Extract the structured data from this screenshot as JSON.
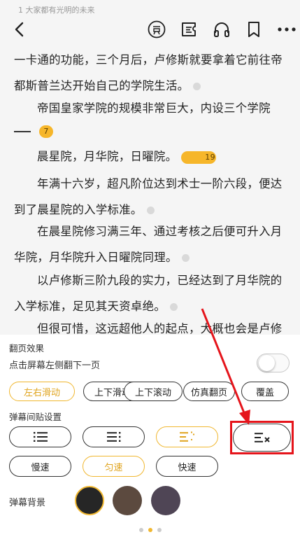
{
  "header": {
    "breadcrumb": "1 大家都有光明的未来"
  },
  "reader": {
    "paragraphs": [
      {
        "text": "一卡通的功能，三个月后，卢修斯就要拿着它前往帝都斯普兰达开始自己的学院生活。"
      },
      {
        "text": "帝国皇家学院的规模非常巨大，内设三个学院",
        "cont": "",
        "badge": "7"
      },
      {
        "text": "晨星院，月华院，日曜院。",
        "badge": "19"
      },
      {
        "text": "年满十六岁，超凡阶位达到术士一阶六段，便达到了晨星院的入学标准。"
      },
      {
        "text": "在晨星院修习满三年、通过考核之后便可升入月华院，月华院升入日曜院同理。"
      },
      {
        "text": "以卢修斯三阶九段的实力，已经达到了月华院的入学标准，足见其天资卓绝。"
      },
      {
        "text": "但很可惜，这远超他人的起点，大概也会是卢修"
      }
    ]
  },
  "panel": {
    "page_turn_title": "翻页效果",
    "tap_left_label": "点击屏幕左侧翻下一页",
    "tap_left_enabled": false,
    "page_modes": [
      "左右滑动",
      "上下滑动",
      "上下滚动",
      "仿真翻页",
      "覆盖"
    ],
    "selected_page_mode": 0,
    "danmaku_title": "弹幕间贴设置",
    "danmaku_modes_selected": 2,
    "speeds": [
      "慢速",
      "匀速",
      "快速"
    ],
    "selected_speed": 1,
    "bg_title": "弹幕背景",
    "bg_colors": [
      "#262626",
      "#5c4a3f",
      "#4f4555"
    ],
    "selected_bg": 0
  },
  "icons": [
    "back-icon",
    "reward-icon",
    "toc-icon",
    "headphones-icon",
    "bookmark-icon",
    "more-icon"
  ],
  "colors": {
    "accent": "#f0b730",
    "annotation": "#e5141b"
  }
}
